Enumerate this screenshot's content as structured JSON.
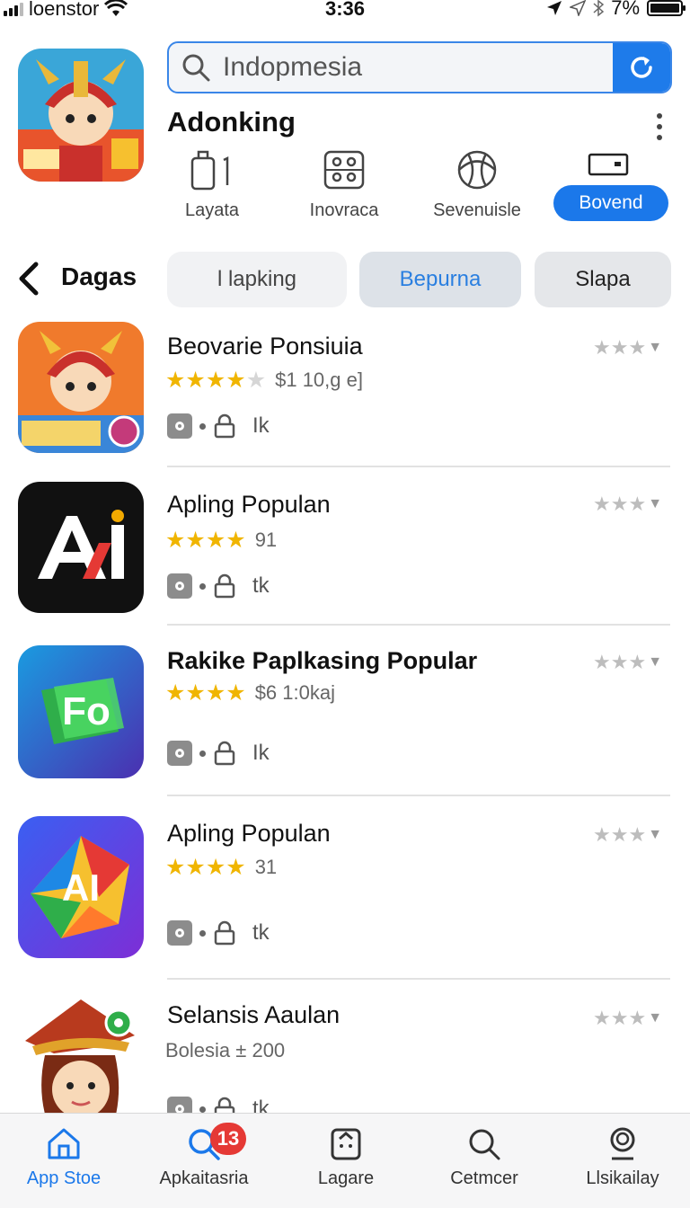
{
  "status_bar": {
    "carrier": "loenstor",
    "time": "3:36",
    "battery": "7%"
  },
  "search": {
    "value": "Indopmesia"
  },
  "header": {
    "app_name": "Adonking"
  },
  "categories": [
    {
      "label": "Layata",
      "icon": "phone-icon"
    },
    {
      "label": "Inovraca",
      "icon": "controller-icon"
    },
    {
      "label": "Sevenuisle",
      "icon": "ball-icon"
    },
    {
      "label": "Bovend",
      "icon": "card-icon",
      "active": true
    }
  ],
  "filter": {
    "title": "Dagas",
    "pills": [
      "l lapking",
      "Bepurna",
      "Slapa"
    ]
  },
  "apps": [
    {
      "name": "Beovarie Ponsiuia",
      "stars": 3.5,
      "meta": "$1 10,g e]",
      "tag": "Ik",
      "colors": [
        "#f0652f",
        "#f6a43a"
      ]
    },
    {
      "name": "Apling Populan",
      "stars": 4,
      "meta": "91",
      "tag": "tk",
      "colors": [
        "#111111",
        "#111111"
      ]
    },
    {
      "name": "Rakike Paplkasing Popular",
      "stars": 4,
      "meta": "$6 1:0kaj",
      "tag": "Ik",
      "colors": [
        "#1e88d8",
        "#4a3fb0"
      ]
    },
    {
      "name": "Apling Populan",
      "stars": 3.5,
      "meta": "31",
      "tag": "tk",
      "colors": [
        "#3b5cf0",
        "#7b2fd0"
      ]
    },
    {
      "name": "Selansis Aaulan",
      "meta": "Bolesia ± 200",
      "tag": "tk",
      "colors": [
        "#ffffff",
        "#ffffff"
      ]
    }
  ],
  "tabbar": [
    {
      "label": "App Stoe",
      "icon": "home-icon",
      "active": true
    },
    {
      "label": "Apkaitasria",
      "icon": "search-icon",
      "badge": "13"
    },
    {
      "label": "Lagare",
      "icon": "bag-icon"
    },
    {
      "label": "Cetmcer",
      "icon": "search-icon"
    },
    {
      "label": "Llsikailay",
      "icon": "account-icon"
    }
  ]
}
